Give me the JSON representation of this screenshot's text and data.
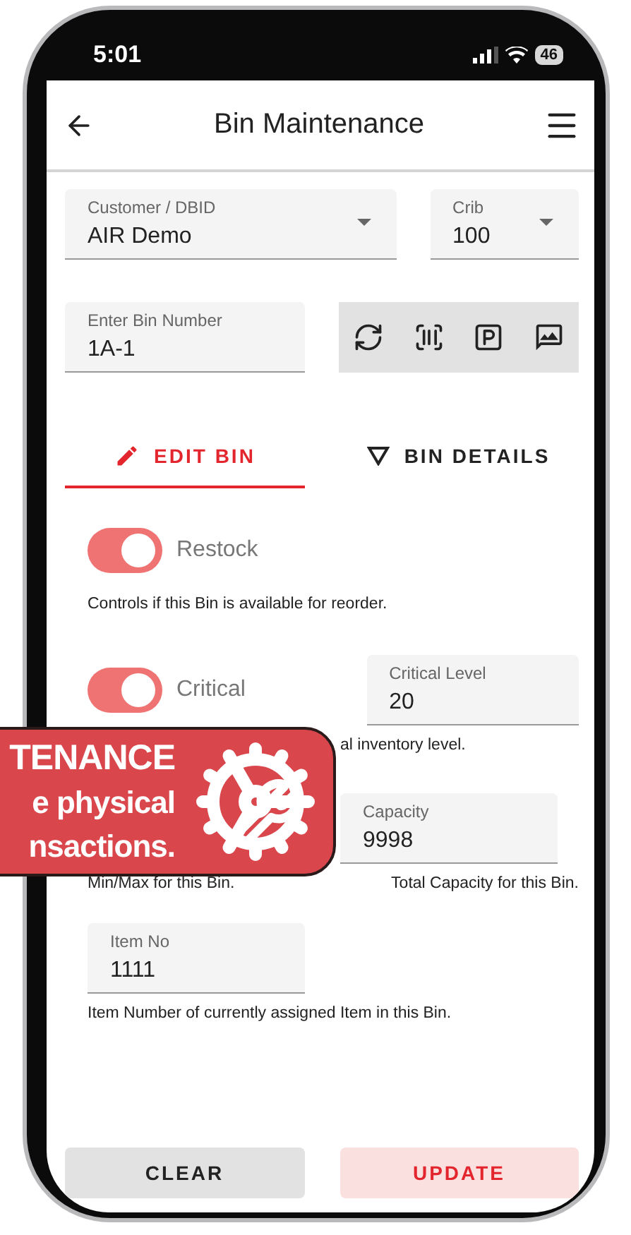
{
  "status_bar": {
    "time": "5:01",
    "battery": "46"
  },
  "header": {
    "title": "Bin Maintenance"
  },
  "selectors": [
    {
      "label": "Customer / DBID",
      "value": "AIR Demo"
    },
    {
      "label": "Crib",
      "value": "100"
    }
  ],
  "bin_field": {
    "label": "Enter Bin Number",
    "value": "1A-1"
  },
  "tabs": [
    {
      "label": "EDIT BIN",
      "selected": true,
      "kind": "edit"
    },
    {
      "label": "BIN DETAILS",
      "selected": false,
      "kind": "details"
    }
  ],
  "restock": {
    "label": "Restock",
    "on": true,
    "helper": "Controls if this Bin is available for reorder."
  },
  "critical": {
    "label": "Critical",
    "on": true,
    "field_label": "Critical Level",
    "value": "20",
    "helper": "al inventory level."
  },
  "minmax": {
    "helper": "Min/Max for this Bin."
  },
  "capacity": {
    "label": "Capacity",
    "value": "9998",
    "helper": "Total Capacity for this Bin."
  },
  "item": {
    "label": "Item No",
    "value": "1111",
    "helper": "Item Number of currently assigned Item in this Bin."
  },
  "buttons": [
    {
      "label": "CLEAR",
      "kind": "secondary"
    },
    {
      "label": "UPDATE",
      "kind": "primary"
    }
  ],
  "banner": {
    "lines": [
      "TENANCE",
      "e physical",
      "nsactions."
    ]
  }
}
